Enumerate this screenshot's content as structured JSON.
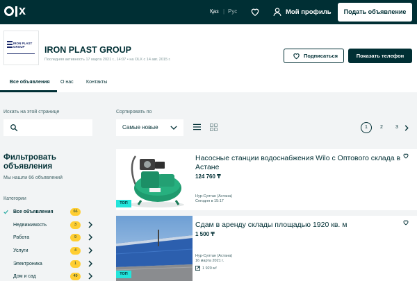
{
  "header": {
    "lang_kaz": "Қаз",
    "lang_sep": "|",
    "lang_rus": "Рус",
    "profile_label": "Мой профиль",
    "post_button": "Подать объявление"
  },
  "shop": {
    "logo_text": "IRON PLAST GROUP",
    "name": "IRON PLAST GROUP",
    "activity": "Последняя активность 17 марта 2021 г., 14:07  •  на OLX с 14 авг. 2015 г.",
    "subscribe_label": "Подписаться",
    "phone_label": "Показать телефон",
    "tabs": [
      "Все объявления",
      "О нас",
      "Контакты"
    ]
  },
  "search": {
    "label": "Искать на этой странице"
  },
  "sort": {
    "label": "Сортировать по",
    "value": "Самые новые"
  },
  "pagination": {
    "pages": [
      "1",
      "2",
      "3"
    ],
    "current": "1"
  },
  "filters": {
    "title": "Фильтровать объявления",
    "found": "Мы нашли 66 объявлений",
    "categories_label": "Категории",
    "categories": [
      {
        "name": "Все объявления",
        "count": "66"
      },
      {
        "name": "Недвижимость",
        "count": "3"
      },
      {
        "name": "Работа",
        "count": "9"
      },
      {
        "name": "Услуги",
        "count": "4"
      },
      {
        "name": "Электроника",
        "count": "1"
      },
      {
        "name": "Дом и сад",
        "count": "49"
      }
    ]
  },
  "listings": [
    {
      "title": "Насосные станции водоснабжения Wilo с Оптового склада в Астане",
      "price": "124 760 ₸",
      "location": "Нур-Султан (Астана)",
      "date": "Сегодня в 15:17",
      "badge": "ТОП"
    },
    {
      "title": "Сдам в аренду склады площадью 1920 кв. м",
      "price": "1 500 ₸",
      "location": "Нур-Султан (Астана)",
      "date": "16 марта 2021 г.",
      "area": "1 920 м²",
      "badge": "ТОП"
    }
  ],
  "colors": {
    "brand_dark": "#002f34",
    "top_badge": "#23e5db",
    "count_badge": "#ffce32"
  }
}
